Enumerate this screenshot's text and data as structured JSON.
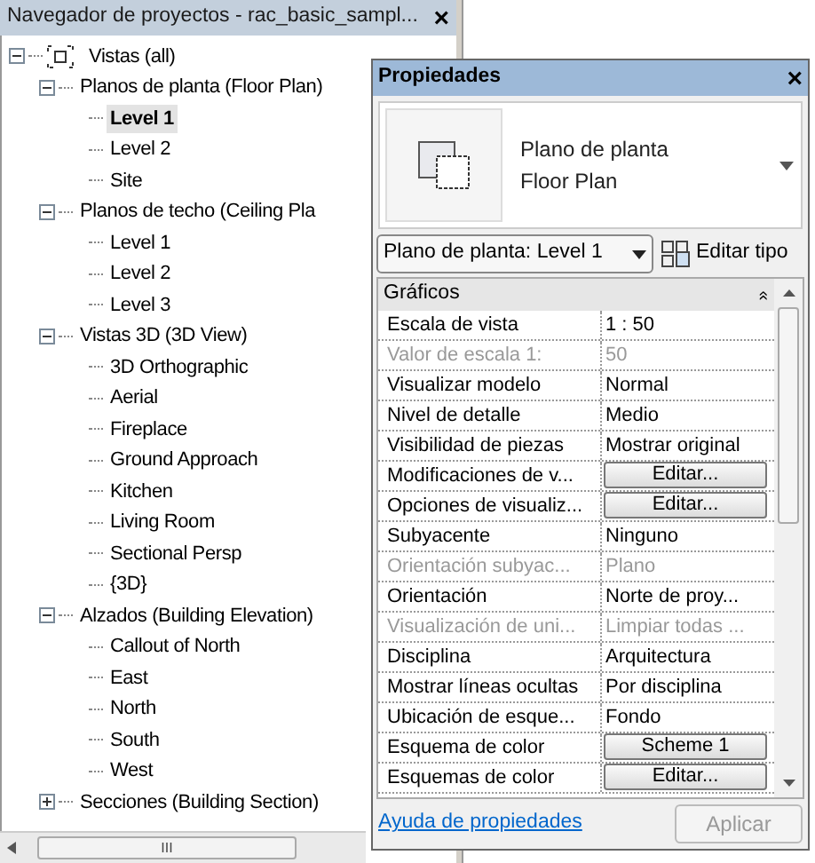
{
  "browser": {
    "title": "Navegador de proyectos - rac_basic_sampl...",
    "close": "×",
    "tree": [
      {
        "label": "Vistas (all)",
        "expanded": true,
        "selected": false,
        "children": [
          {
            "label": "Planos de planta (Floor Plan)",
            "expanded": true,
            "selected": false,
            "children": [
              {
                "label": "Level 1",
                "selected": true
              },
              {
                "label": "Level 2",
                "selected": false
              },
              {
                "label": "Site",
                "selected": false
              }
            ]
          },
          {
            "label": "Planos de techo (Ceiling Pla",
            "expanded": true,
            "selected": false,
            "children": [
              {
                "label": "Level 1",
                "selected": false
              },
              {
                "label": "Level 2",
                "selected": false
              },
              {
                "label": "Level 3",
                "selected": false
              }
            ]
          },
          {
            "label": "Vistas 3D (3D View)",
            "expanded": true,
            "selected": false,
            "children": [
              {
                "label": "3D Orthographic",
                "selected": false
              },
              {
                "label": "Aerial",
                "selected": false
              },
              {
                "label": "Fireplace",
                "selected": false
              },
              {
                "label": "Ground Approach",
                "selected": false
              },
              {
                "label": "Kitchen",
                "selected": false
              },
              {
                "label": "Living Room",
                "selected": false
              },
              {
                "label": "Sectional Persp",
                "selected": false
              },
              {
                "label": "{3D}",
                "selected": false
              }
            ]
          },
          {
            "label": "Alzados (Building Elevation)",
            "expanded": true,
            "selected": false,
            "children": [
              {
                "label": "Callout of North",
                "selected": false
              },
              {
                "label": "East",
                "selected": false
              },
              {
                "label": "North",
                "selected": false
              },
              {
                "label": "South",
                "selected": false
              },
              {
                "label": "West",
                "selected": false
              }
            ]
          },
          {
            "label": "Secciones (Building Section)",
            "expanded": false,
            "selected": false
          }
        ]
      }
    ],
    "scroll_thumb": "III"
  },
  "properties": {
    "title": "Propiedades",
    "close": "×",
    "type_name": "Plano de planta",
    "type_subname": "Floor Plan",
    "instance_dropdown": "Plano de planta: Level 1",
    "edit_type": "Editar tipo",
    "group": "Gráficos",
    "group_toggle": "»",
    "rows": [
      {
        "kind": "text",
        "label": "Escala de vista",
        "value": "1 : 50",
        "disabled": false
      },
      {
        "kind": "text",
        "label": "Valor de escala    1:",
        "value": "50",
        "disabled": true
      },
      {
        "kind": "text",
        "label": "Visualizar modelo",
        "value": "Normal",
        "disabled": false
      },
      {
        "kind": "text",
        "label": "Nivel de detalle",
        "value": "Medio",
        "disabled": false
      },
      {
        "kind": "text",
        "label": "Visibilidad de piezas",
        "value": "Mostrar original",
        "disabled": false
      },
      {
        "kind": "button",
        "label": "Modificaciones de v...",
        "value": "Editar...",
        "disabled": false
      },
      {
        "kind": "button",
        "label": "Opciones de visualiz...",
        "value": "Editar...",
        "disabled": false
      },
      {
        "kind": "text",
        "label": "Subyacente",
        "value": "Ninguno",
        "disabled": false
      },
      {
        "kind": "text",
        "label": "Orientación subyac...",
        "value": "Plano",
        "disabled": true
      },
      {
        "kind": "text",
        "label": "Orientación",
        "value": "Norte de proy...",
        "disabled": false
      },
      {
        "kind": "text",
        "label": "Visualización de uni...",
        "value": "Limpiar todas ...",
        "disabled": true
      },
      {
        "kind": "text",
        "label": "Disciplina",
        "value": "Arquitectura",
        "disabled": false
      },
      {
        "kind": "text",
        "label": "Mostrar líneas ocultas",
        "value": "Por disciplina",
        "disabled": false
      },
      {
        "kind": "text",
        "label": "Ubicación de esque...",
        "value": "Fondo",
        "disabled": false
      },
      {
        "kind": "button",
        "label": "Esquema de color",
        "value": "Scheme 1",
        "disabled": false
      },
      {
        "kind": "button",
        "label": "Esquemas de color",
        "value": "Editar...",
        "disabled": false
      }
    ],
    "help_link": "Ayuda de propiedades",
    "apply": "Aplicar",
    "apply_disabled": true
  }
}
